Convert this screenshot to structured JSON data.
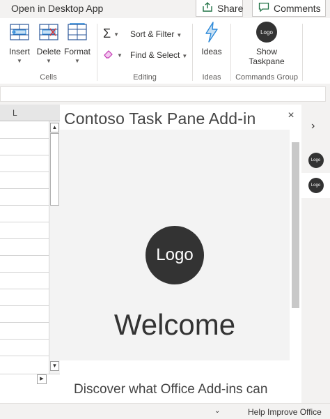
{
  "topbar": {
    "open_desktop_label": "Open in Desktop App",
    "share_label": "Share",
    "comments_label": "Comments"
  },
  "ribbon": {
    "cells": {
      "insert_label": "Insert",
      "delete_label": "Delete",
      "format_label": "Format",
      "group_label": "Cells"
    },
    "editing": {
      "sum_symbol": "Σ",
      "sort_filter_label": "Sort & Filter",
      "find_select_label": "Find & Select",
      "group_label": "Editing"
    },
    "ideas": {
      "ideas_label": "Ideas",
      "group_label": "Ideas"
    },
    "commands": {
      "logo_text": "Logo",
      "show_label_line1": "Show",
      "show_label_line2": "Taskpane",
      "group_label": "Commands Group"
    }
  },
  "grid": {
    "column_header": "L"
  },
  "taskpane": {
    "title": "Contoso Task Pane Add-in",
    "close_symbol": "×",
    "logo_text": "Logo",
    "welcome": "Welcome",
    "discover_text": "Discover what Office Add-ins can"
  },
  "rightstrip": {
    "chevron": "›",
    "item1_logo": "Logo",
    "item2_logo": "Logo"
  },
  "statusbar": {
    "chevron": "⌄",
    "help_label": "Help Improve Office"
  },
  "colors": {
    "ribbon_background": "#ffffff",
    "chrome_background": "#f3f2f1",
    "accent_green": "#217346",
    "logo_dark": "#333333",
    "ideas_blue": "#2b88d8",
    "eraser_pink": "#c239b3"
  }
}
